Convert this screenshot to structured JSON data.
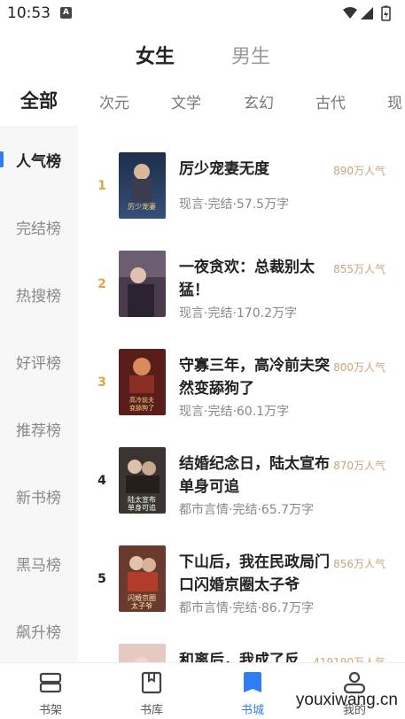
{
  "status_bar": {
    "time": "10:53",
    "indicator": "A"
  },
  "gender_tabs": {
    "female": "女生",
    "male": "男生"
  },
  "category_tabs": [
    "全部",
    "次元",
    "文学",
    "玄幻",
    "古代",
    "现"
  ],
  "sidebar": [
    "人气榜",
    "完结榜",
    "热搜榜",
    "好评榜",
    "推荐榜",
    "新书榜",
    "黑马榜",
    "飙升榜"
  ],
  "books": [
    {
      "rank": "1",
      "title": "厉少宠妻无度",
      "meta": "现言·完结·57.5万字",
      "popularity": "890万人气",
      "cover_text": "厉少宠妻无度"
    },
    {
      "rank": "2",
      "title": "一夜贪欢：总裁别太猛！",
      "meta": "现言·完结·170.2万字",
      "popularity": "855万人气",
      "cover_text": ""
    },
    {
      "rank": "3",
      "title": "守寡三年，高冷前夫突然变舔狗了",
      "meta": "现言·完结·60.1万字",
      "popularity": "800万人气",
      "cover_text": "高冷前夫突然变舔狗了"
    },
    {
      "rank": "4",
      "title": "结婚纪念日，陆太宣布单身可追",
      "meta": "都市言情·完结·65.7万字",
      "popularity": "870万人气",
      "cover_text": "陆太宣布单身可追"
    },
    {
      "rank": "5",
      "title": "下山后，我在民政局门口闪婚京圈太子爷",
      "meta": "都市言情·完结·86.7万字",
      "popularity": "856万人气",
      "cover_text": "闪婚京圈太子爷"
    },
    {
      "rank": "",
      "title": "和离后，我成了反",
      "meta": "",
      "popularity": "419190万人气",
      "cover_text": ""
    }
  ],
  "bottom_nav": [
    {
      "label": "书架",
      "icon": "bookshelf-icon"
    },
    {
      "label": "书库",
      "icon": "library-icon"
    },
    {
      "label": "书城",
      "icon": "bookstore-icon"
    },
    {
      "label": "我的",
      "icon": "profile-icon"
    }
  ],
  "watermark": "youxiwang.cn",
  "colors": {
    "accent": "#2e7cf6",
    "rank_top": "#e8a33d",
    "popularity": "#c9a57a"
  }
}
